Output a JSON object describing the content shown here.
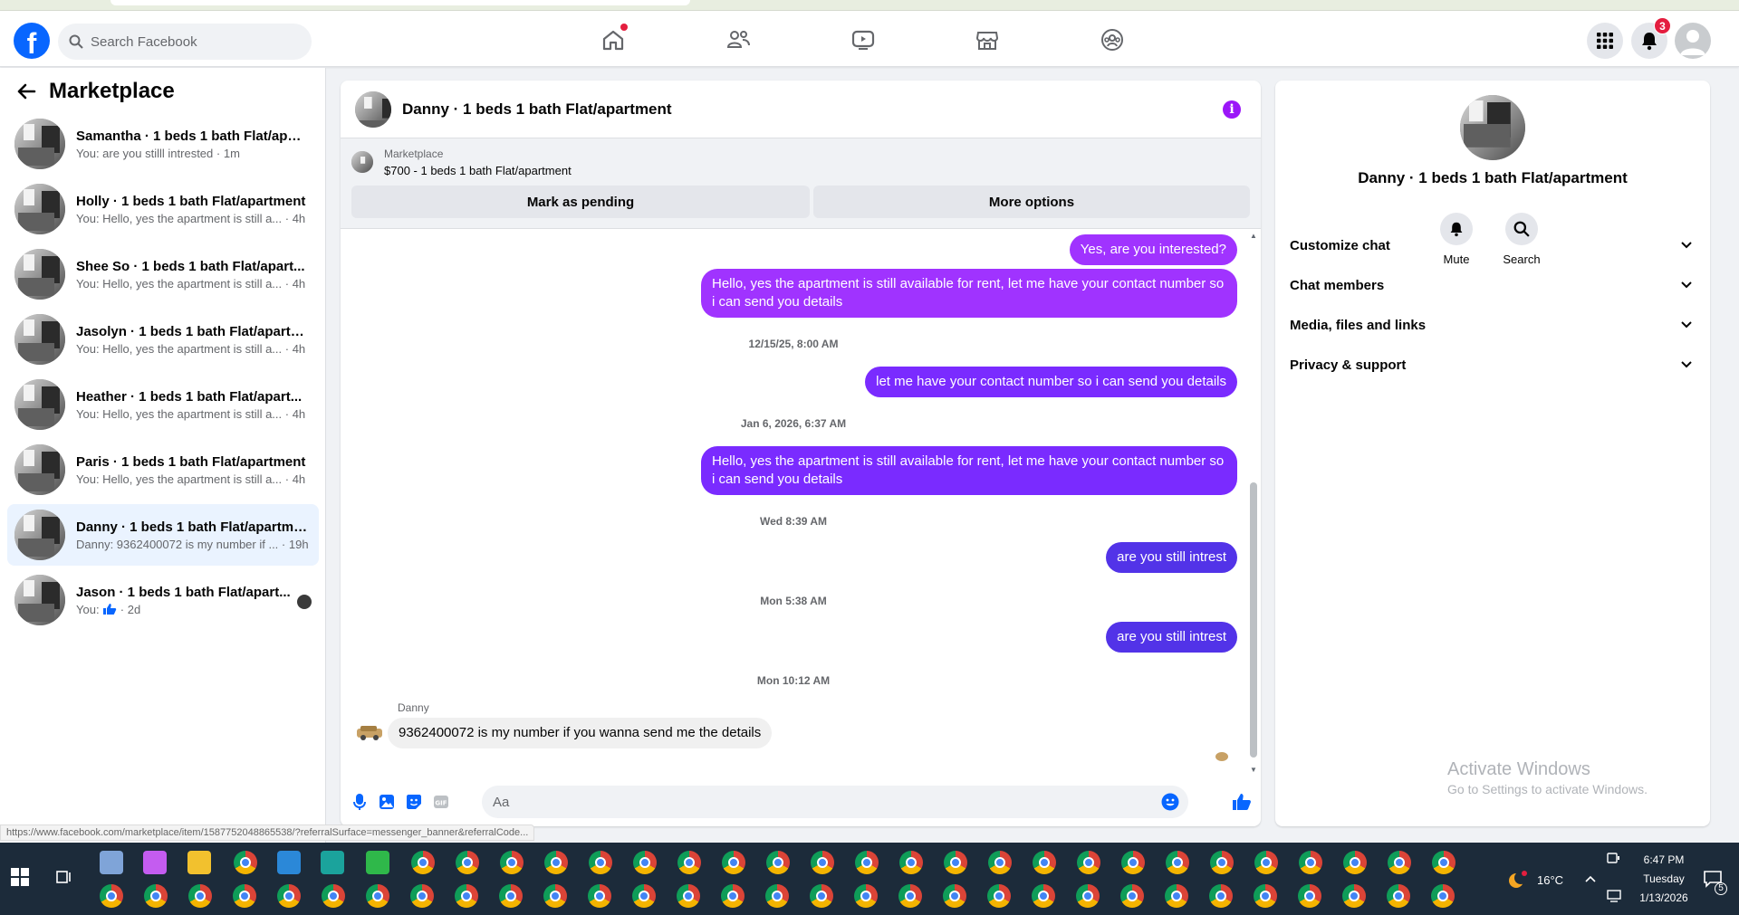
{
  "header": {
    "search_placeholder": "Search Facebook",
    "notifications_count": "3",
    "brand_color": "#0866ff"
  },
  "left": {
    "title": "Marketplace",
    "conversations": [
      {
        "name": "Samantha · 1 beds 1 bath Flat/apar...",
        "preview": "You: are you stilll intrested",
        "time": "· 1m"
      },
      {
        "name": "Holly · 1 beds 1 bath Flat/apartment",
        "preview": "You: Hello, yes the apartment is still a...",
        "time": "· 4h"
      },
      {
        "name": "Shee So · 1 beds 1 bath Flat/apart...",
        "preview": "You: Hello, yes the apartment is still a...",
        "time": "· 4h"
      },
      {
        "name": "Jasolyn · 1 beds 1 bath Flat/apartm...",
        "preview": "You: Hello, yes the apartment is still a...",
        "time": "· 4h"
      },
      {
        "name": "Heather · 1 beds 1 bath Flat/apart...",
        "preview": "You: Hello, yes the apartment is still a...",
        "time": "· 4h"
      },
      {
        "name": "Paris · 1 beds 1 bath Flat/apartment",
        "preview": "You: Hello, yes the apartment is still a...",
        "time": "· 4h"
      },
      {
        "name": "Danny · 1 beds 1 bath Flat/apartme...",
        "preview": "Danny: 9362400072 is my number if ...",
        "time": "· 19h"
      },
      {
        "name": "Jason · 1 beds 1 bath Flat/apart...",
        "preview": "You: ",
        "time": "· 2d"
      }
    ]
  },
  "chat": {
    "title": "Danny · 1 beds 1 bath Flat/apartment",
    "info_icon": "i",
    "marketplace_label": "Marketplace",
    "listing": "$700 - 1 beds 1 bath Flat/apartment",
    "mark_pending": "Mark as pending",
    "more_options": "More options",
    "messages": {
      "m1": "Yes, are you interested?",
      "m2": "Hello, yes the apartment is still available for rent, let me have your contact number so i can send you details",
      "t1": "12/15/25, 8:00 AM",
      "m3": "let me have your contact number so i can send you details",
      "t2": "Jan 6, 2026, 6:37 AM",
      "m4": "Hello, yes the apartment is still available for rent, let me have your contact number so i can send you details",
      "t3": "Wed 8:39 AM",
      "m5": "are you still intrest",
      "t4": "Mon 5:38 AM",
      "m6": "are you still intrest",
      "t5": "Mon 10:12 AM",
      "sender": "Danny",
      "m7": "9362400072 is my number if you wanna send me the details"
    },
    "composer_placeholder": "Aa"
  },
  "info": {
    "title": "Danny · 1 beds 1 bath Flat/apartment",
    "mute_label": "Mute",
    "search_label": "Search",
    "rows": [
      "Customize chat",
      "Chat members",
      "Media, files and links",
      "Privacy & support"
    ],
    "watermark_title": "Activate Windows",
    "watermark_sub": "Go to Settings to activate Windows."
  },
  "status_url": "https://www.facebook.com/marketplace/item/1587752048865538/?referralSurface=messenger_banner&referralCode...",
  "taskbar": {
    "temperature": "16°C",
    "time": "6:47 PM",
    "day": "Tuesday",
    "date": "1/13/2026",
    "notif_count": "5"
  }
}
